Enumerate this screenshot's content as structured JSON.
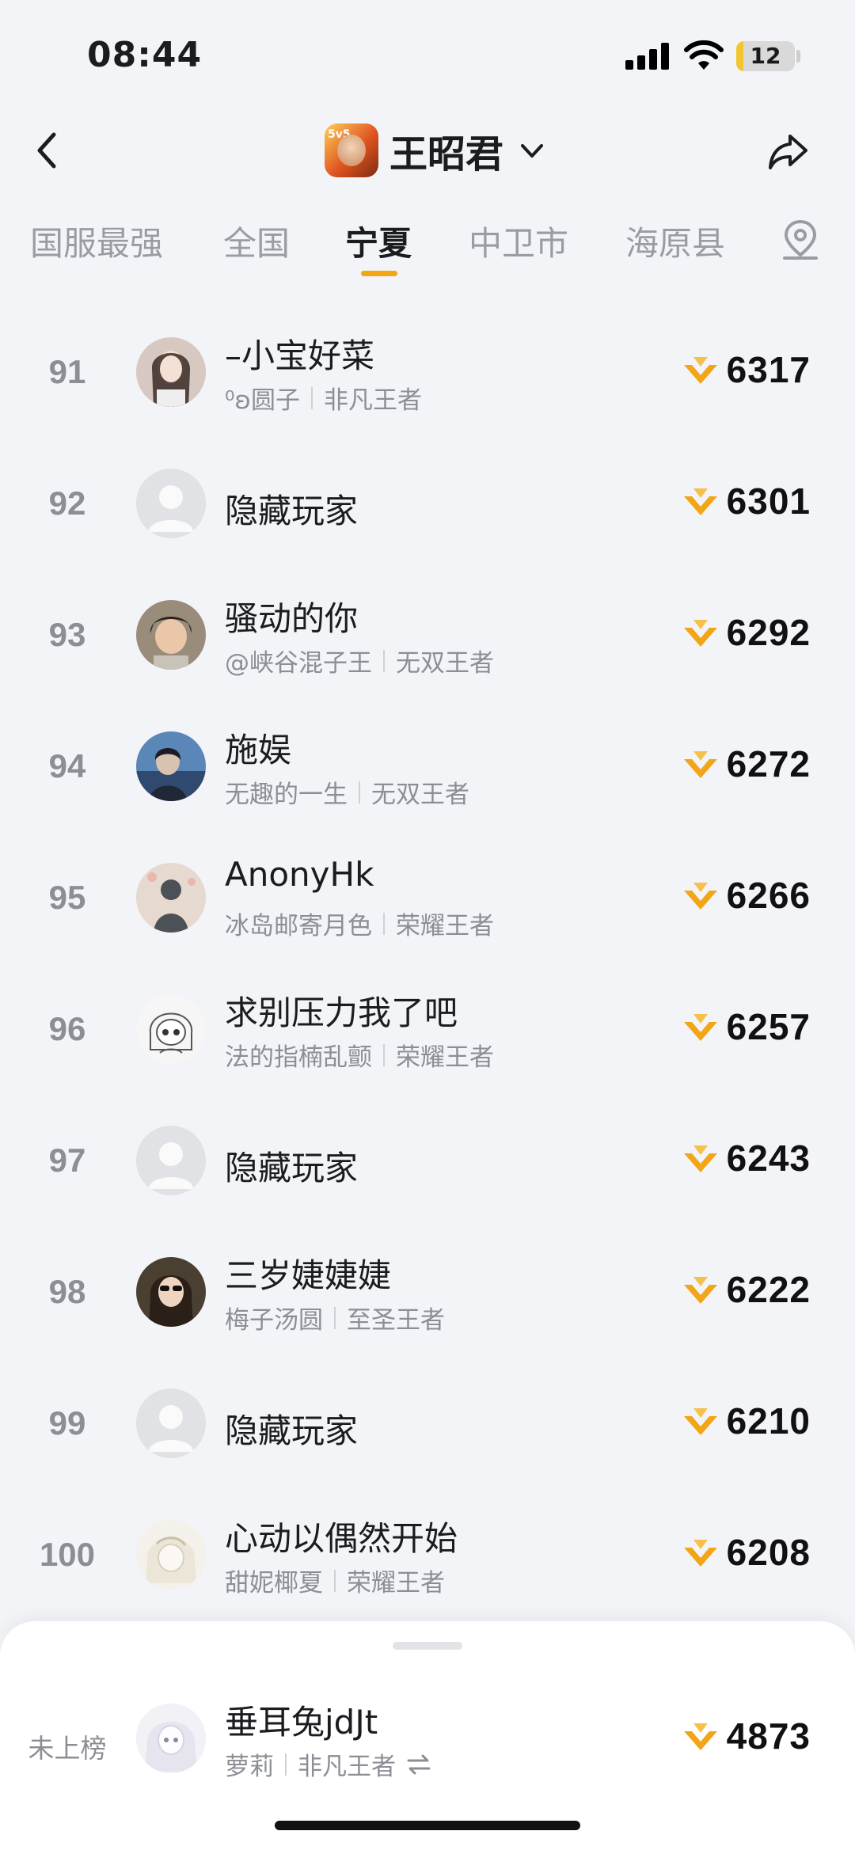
{
  "status": {
    "time": "08:44",
    "battery_level": "12",
    "battery_fill_percent": 12
  },
  "nav": {
    "title": "王昭君",
    "game_badge": "5v5"
  },
  "tabs": [
    {
      "label": "国服最强",
      "active": false
    },
    {
      "label": "全国",
      "active": false
    },
    {
      "label": "宁夏",
      "active": true
    },
    {
      "label": "中卫市",
      "active": false
    },
    {
      "label": "海原县",
      "active": false
    }
  ],
  "list": [
    {
      "rank": "91",
      "name": "–小宝好菜",
      "tag": "⁰ʚ圆子",
      "title": "非凡王者",
      "score": "6317"
    },
    {
      "rank": "92",
      "name": "隐藏玩家",
      "tag": "",
      "title": "",
      "score": "6301"
    },
    {
      "rank": "93",
      "name": "骚动的你",
      "tag": "@峡谷混子王",
      "title": "无双王者",
      "score": "6292"
    },
    {
      "rank": "94",
      "name": "施娱",
      "tag": "无趣的一生",
      "title": "无双王者",
      "score": "6272"
    },
    {
      "rank": "95",
      "name": "AnonyHk",
      "tag": "冰岛邮寄月色",
      "title": "荣耀王者",
      "score": "6266"
    },
    {
      "rank": "96",
      "name": "求别压力我了吧",
      "tag": "法的指楠乱颤",
      "title": "荣耀王者",
      "score": "6257"
    },
    {
      "rank": "97",
      "name": "隐藏玩家",
      "tag": "",
      "title": "",
      "score": "6243"
    },
    {
      "rank": "98",
      "name": "三岁婕婕婕",
      "tag": "梅子汤圆",
      "title": "至圣王者",
      "score": "6222"
    },
    {
      "rank": "99",
      "name": "隐藏玩家",
      "tag": "",
      "title": "",
      "score": "6210"
    },
    {
      "rank": "100",
      "name": "心动以偶然开始",
      "tag": "甜妮椰夏",
      "title": "荣耀王者",
      "score": "6208"
    }
  ],
  "me": {
    "rank_label": "未上榜",
    "name": "垂耳兔jdJt",
    "tag": "萝莉",
    "title": "非凡王者",
    "score": "4873"
  },
  "colors": {
    "accent": "#f2a516",
    "background": "#f3f4f7"
  }
}
